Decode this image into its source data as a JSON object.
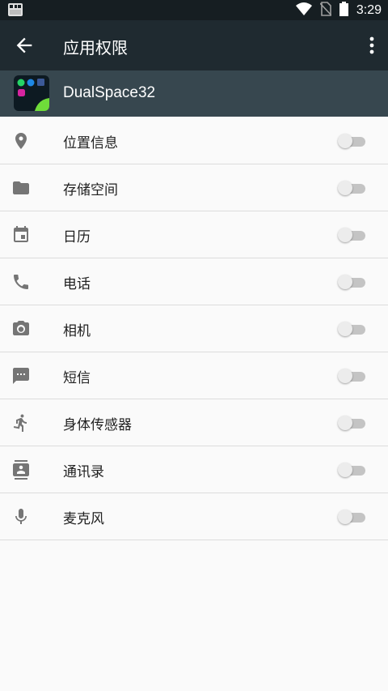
{
  "status_bar": {
    "time": "3:29"
  },
  "toolbar": {
    "title": "应用权限"
  },
  "app": {
    "name": "DualSpace32"
  },
  "permissions": [
    {
      "label": "位置信息",
      "icon": "location-icon",
      "enabled": false
    },
    {
      "label": "存储空间",
      "icon": "folder-icon",
      "enabled": false
    },
    {
      "label": "日历",
      "icon": "calendar-icon",
      "enabled": false
    },
    {
      "label": "电话",
      "icon": "phone-icon",
      "enabled": false
    },
    {
      "label": "相机",
      "icon": "camera-icon",
      "enabled": false
    },
    {
      "label": "短信",
      "icon": "sms-icon",
      "enabled": false
    },
    {
      "label": "身体传感器",
      "icon": "body-sensor-icon",
      "enabled": false
    },
    {
      "label": "通讯录",
      "icon": "contacts-icon",
      "enabled": false
    },
    {
      "label": "麦克风",
      "icon": "microphone-icon",
      "enabled": false
    }
  ],
  "colors": {
    "status_bar": "#161e22",
    "toolbar": "#1f2a30",
    "app_header": "#37474f",
    "icon_gray": "#757575",
    "toggle_off_track": "#c4c4c4",
    "toggle_off_thumb": "#ececec"
  }
}
